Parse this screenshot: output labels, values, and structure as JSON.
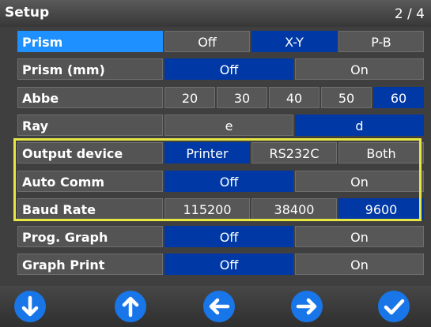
{
  "title": "Setup",
  "page_indicator": "2 / 4",
  "colors": {
    "selected": "#0039a6",
    "active_label": "#1e90ff",
    "highlight_box": "#e6e645",
    "nav_button": "#1976e8"
  },
  "rows": [
    {
      "label": "Prism",
      "active": true,
      "options": [
        "Off",
        "X-Y",
        "P-B"
      ],
      "selected": 1
    },
    {
      "label": "Prism (mm)",
      "active": false,
      "options": [
        "Off",
        "On"
      ],
      "selected": 0
    },
    {
      "label": "Abbe",
      "active": false,
      "options": [
        "20",
        "30",
        "40",
        "50",
        "60"
      ],
      "selected": 4
    },
    {
      "label": "Ray",
      "active": false,
      "options": [
        "e",
        "d"
      ],
      "selected": 1
    },
    {
      "label": "Output device",
      "active": false,
      "options": [
        "Printer",
        "RS232C",
        "Both"
      ],
      "selected": 0
    },
    {
      "label": "Auto Comm",
      "active": false,
      "options": [
        "Off",
        "On"
      ],
      "selected": 0
    },
    {
      "label": "Baud Rate",
      "active": false,
      "options": [
        "115200",
        "38400",
        "9600"
      ],
      "selected": 2
    },
    {
      "label": "Prog. Graph",
      "active": false,
      "options": [
        "Off",
        "On"
      ],
      "selected": 0
    },
    {
      "label": "Graph Print",
      "active": false,
      "options": [
        "Off",
        "On"
      ],
      "selected": 0
    }
  ],
  "nav_buttons": [
    {
      "name": "down-button",
      "icon": "arrow-down-icon"
    },
    {
      "name": "up-button",
      "icon": "arrow-up-icon"
    },
    {
      "name": "left-button",
      "icon": "arrow-left-icon"
    },
    {
      "name": "right-button",
      "icon": "arrow-right-icon"
    },
    {
      "name": "confirm-button",
      "icon": "check-icon"
    }
  ]
}
